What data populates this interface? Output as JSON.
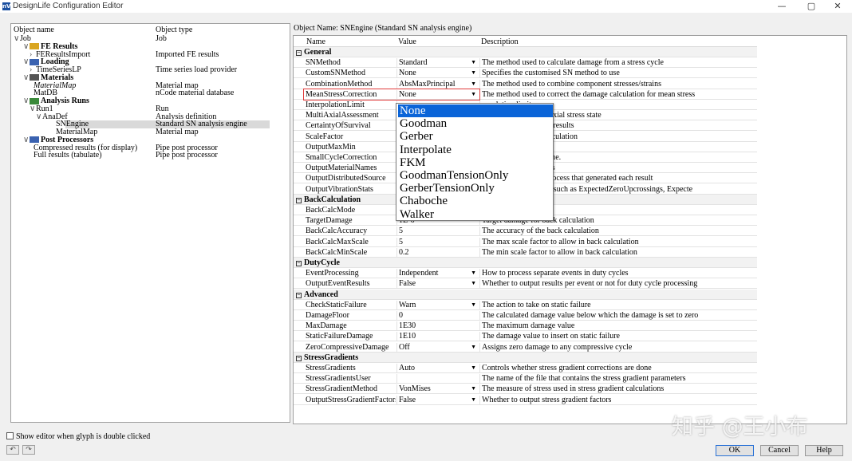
{
  "window": {
    "title": "DesignLife Configuration Editor",
    "logo_text": "nV",
    "minimize": "—",
    "maximize": "▢",
    "close": "✕"
  },
  "tree": {
    "col_name": "Object name",
    "col_type": "Object type",
    "rows": [
      {
        "arrow": "∨",
        "name": "Job",
        "type": "Job",
        "style": ""
      },
      {
        "arrow": "∨",
        "icon": "fe-results-icon",
        "name": "FE Results",
        "type": "",
        "style": "bold"
      },
      {
        "arrow": "›",
        "name": "FEResultsImport",
        "type": "Imported FE results",
        "style": ""
      },
      {
        "arrow": "∨",
        "icon": "loading-icon",
        "name": "Loading",
        "type": "",
        "style": "bold"
      },
      {
        "arrow": "›",
        "name": "TimeSeriesLP",
        "type": "Time series load provider",
        "style": ""
      },
      {
        "arrow": "∨",
        "icon": "materials-icon",
        "name": "Materials",
        "type": "",
        "style": "bold"
      },
      {
        "arrow": "",
        "name": "MaterialMap",
        "type": "Material map",
        "style": "ital"
      },
      {
        "arrow": "",
        "name": "MatDB",
        "type": "nCode material database",
        "style": ""
      },
      {
        "arrow": "∨",
        "icon": "analysis-runs-icon",
        "name": "Analysis Runs",
        "type": "",
        "style": "bold"
      },
      {
        "arrow": "∨",
        "name": "Run1",
        "type": "Run",
        "style": ""
      },
      {
        "arrow": "∨",
        "name": "AnaDef",
        "type": "Analysis definition",
        "style": ""
      },
      {
        "arrow": "",
        "name": "SNEngine",
        "type": "Standard SN analysis engine",
        "style": "selected"
      },
      {
        "arrow": "",
        "name": "MaterialMap",
        "type": "Material map",
        "style": ""
      },
      {
        "arrow": "∨",
        "icon": "post-processors-icon",
        "name": "Post Processors",
        "type": "",
        "style": "bold"
      },
      {
        "arrow": "",
        "name": "Compressed results (for display)",
        "type": "Pipe post processor",
        "style": ""
      },
      {
        "arrow": "",
        "name": "Full results (tabulate)",
        "type": "Pipe post processor",
        "style": ""
      }
    ]
  },
  "object_name_label": "Object Name: SNEngine (Standard SN analysis engine)",
  "grid": {
    "col_name": "Name",
    "col_value": "Value",
    "col_desc": "Description",
    "rows": [
      {
        "cat": "General"
      },
      {
        "name": "SNMethod",
        "value": "Standard",
        "dd": true,
        "desc": "The method used to calculate damage from a stress cycle"
      },
      {
        "name": "CustomSNMethod",
        "value": "None",
        "dd": true,
        "desc": "Specifies the customised SN method to use"
      },
      {
        "name": "CombinationMethod",
        "value": "AbsMaxPrincipal",
        "dd": true,
        "desc": "The method used to combine component stresses/strains"
      },
      {
        "name": "MeanStressCorrection",
        "value": "None",
        "dd": true,
        "desc": "The method used to correct the damage calculation for mean stress",
        "highlight": true
      },
      {
        "name": "InterpolationLimit",
        "value": "",
        "desc": "erpolation limit"
      },
      {
        "name": "MultiAxialAssessment",
        "value": "",
        "desc": "essment of the multi-axial stress state"
      },
      {
        "name": "CertaintyOfSurvival",
        "value": "",
        "desc": "rvival (%) on damage results"
      },
      {
        "name": "ScaleFactor",
        "value": "",
        "desc": "ly prior to damage calculation"
      },
      {
        "name": "OutputMaxMin",
        "value": "",
        "desc": "and min stresses"
      },
      {
        "name": "SmallCycleCorrection",
        "value": "",
        "desc": "in the high cycle regime."
      },
      {
        "name": "OutputMaterialNames",
        "value": "",
        "desc": "ial names to the results"
      },
      {
        "name": "OutputDistributedSource",
        "value": "",
        "desc": "ls of the distributed process that generated each result"
      },
      {
        "name": "OutputVibrationStats",
        "value": "",
        "desc": "ation PSD parameters such as ExpectedZeroUpcrossings, Expecte"
      },
      {
        "cat": "BackCalculation"
      },
      {
        "name": "BackCalcMode",
        "value": "",
        "desc": "ack-calculation or not"
      },
      {
        "name": "TargetDamage",
        "value": "1E-6",
        "desc": "Target damage for back calculation"
      },
      {
        "name": "BackCalcAccuracy",
        "value": "5",
        "desc": "The accuracy of the back calculation"
      },
      {
        "name": "BackCalcMaxScale",
        "value": "5",
        "desc": "The max scale factor to allow in back calculation"
      },
      {
        "name": "BackCalcMinScale",
        "value": "0.2",
        "desc": "The min scale factor to allow in back calculation"
      },
      {
        "cat": "DutyCycle"
      },
      {
        "name": "EventProcessing",
        "value": "Independent",
        "dd": true,
        "desc": "How to process separate events in duty cycles"
      },
      {
        "name": "OutputEventResults",
        "value": "False",
        "dd": true,
        "desc": "Whether to output results per event or not for duty cycle processing"
      },
      {
        "cat": "Advanced"
      },
      {
        "name": "CheckStaticFailure",
        "value": "Warn",
        "dd": true,
        "desc": "The action to take on static failure"
      },
      {
        "name": "DamageFloor",
        "value": "0",
        "desc": "The calculated damage value below which the damage is set to zero"
      },
      {
        "name": "MaxDamage",
        "value": "1E30",
        "desc": "The maximum damage value"
      },
      {
        "name": "StaticFailureDamage",
        "value": "1E10",
        "desc": "The damage value to insert on static failure"
      },
      {
        "name": "ZeroCompressiveDamage",
        "value": "Off",
        "dd": true,
        "desc": "Assigns zero damage to any compressive cycle"
      },
      {
        "cat": "StressGradients"
      },
      {
        "name": "StressGradients",
        "value": "Auto",
        "dd": true,
        "desc": "Controls whether stress gradient corrections are done"
      },
      {
        "name": "StressGradientsUser",
        "value": "",
        "desc": "The name of the file that contains the stress gradient parameters"
      },
      {
        "name": "StressGradientMethod",
        "value": "VonMises",
        "dd": true,
        "desc": "The measure of stress used in stress gradient calculations"
      },
      {
        "name": "OutputStressGradientFactors",
        "value": "False",
        "dd": true,
        "desc": "Whether to output stress gradient factors"
      }
    ]
  },
  "dropdown": {
    "items": [
      "None",
      "Goodman",
      "Gerber",
      "Interpolate",
      "FKM",
      "GoodmanTensionOnly",
      "GerberTensionOnly",
      "Chaboche",
      "Walker"
    ],
    "selected": 0
  },
  "bottom": {
    "show_editor": "Show editor when glyph is double clicked",
    "ok": "OK",
    "cancel": "Cancel",
    "help": "Help"
  },
  "watermark": "知乎 @王小布",
  "colors": {
    "accent": "#0a64d8",
    "highlight": "#e03a3a"
  }
}
